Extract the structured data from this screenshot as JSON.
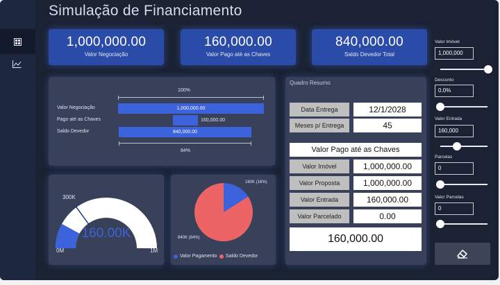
{
  "title": "Simulação de Financiamento",
  "nav": [
    {
      "icon": "dashboard-icon",
      "active": true
    },
    {
      "icon": "line-chart-icon",
      "active": false
    }
  ],
  "kpis": [
    {
      "value": "1,000,000.00",
      "label": "Valor Negociação"
    },
    {
      "value": "160,000.00",
      "label": "Valor Pago até as Chaves"
    },
    {
      "value": "840,000.00",
      "label": "Saldo Devedor Total"
    }
  ],
  "bar_panel": {
    "top_pct_label": "100%",
    "bottom_pct_label": "84%",
    "rows": [
      {
        "label": "Valor Negociação",
        "value_text": "1,000,000.00",
        "value": 1000000,
        "offset": 0
      },
      {
        "label": "Pago até as Chaves",
        "value_text": "160,000.00",
        "value": 160000,
        "offset": 0
      },
      {
        "label": "Saldo Devedor",
        "value_text": "840,000.00",
        "value": 840000,
        "offset": 0
      }
    ],
    "max": 1000000
  },
  "gauge": {
    "value_text": "160.00K",
    "value": 160000,
    "max": 1000000,
    "target": 300000,
    "target_label": "300K",
    "min_label": "0M",
    "max_label": "1M",
    "colors": {
      "fill": "#3d63dc",
      "track": "#ffffff",
      "target": "#1b3a8a"
    }
  },
  "pie": {
    "slices": [
      {
        "name": "Valor Pagamento",
        "value": 160000,
        "label": "160K (16%)",
        "color": "#3d63dc"
      },
      {
        "name": "Saldo Devedor",
        "value": 840000,
        "label": "840K (84%)",
        "color": "#ec6466"
      }
    ]
  },
  "quadro": {
    "title": "Quadro Resumo",
    "top_rows": [
      {
        "label": "Data Entrega",
        "value": "12/1/2028"
      },
      {
        "label": "Meses p/ Entrega",
        "value": "45"
      }
    ],
    "section_title": "Valor Pago até as Chaves",
    "rows": [
      {
        "label": "Valor Imóvel",
        "value": "1,000,000.00"
      },
      {
        "label": "Valor Proposta",
        "value": "1,000,000.00"
      },
      {
        "label": "Valor Entrada",
        "value": "160,000.00"
      },
      {
        "label": "Valor Parcelado",
        "value": "0.00"
      }
    ],
    "total": "160,000.00"
  },
  "slicers": [
    {
      "label": "Valor Imóvel",
      "value": "1,000,000",
      "position": 1.0
    },
    {
      "label": "Desconto",
      "value": "0.0%",
      "position": 0.0
    },
    {
      "label": "Valor Entrada",
      "value": "160,000",
      "position": 0.35
    },
    {
      "label": "Parcelas",
      "value": "0",
      "position": 0.0
    },
    {
      "label": "Valor Parcelas",
      "value": "0",
      "position": 0.0
    }
  ],
  "clear_button_icon": "eraser-icon"
}
